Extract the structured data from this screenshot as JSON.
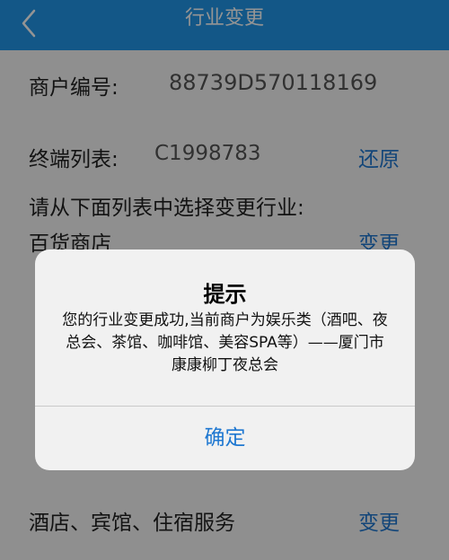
{
  "nav": {
    "title": "行业变更",
    "back_icon": "chevron-left-icon"
  },
  "merchant": {
    "label": "商户编号:",
    "value": "88739D570118169"
  },
  "terminal": {
    "label": "终端列表:",
    "value": "C1998783",
    "action": "还原"
  },
  "prompt": "请从下面列表中选择变更行业:",
  "industries": [
    {
      "name": "百货商店",
      "action": "变更"
    },
    {
      "name": "酒店、宾馆、住宿服务",
      "action": "变更"
    }
  ],
  "dialog": {
    "title": "提示",
    "message": "您的行业变更成功,当前商户为娱乐类（酒吧、夜总会、茶馆、咖啡馆、美容SPA等）——厦门市康康柳丁夜总会",
    "confirm": "确定"
  },
  "colors": {
    "nav": "#2196e8",
    "link": "#1f78d1",
    "overlay": "rgba(0,0,0,0.42)"
  }
}
